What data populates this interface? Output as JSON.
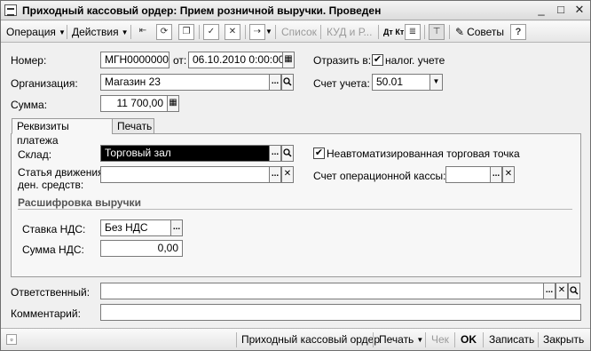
{
  "window": {
    "title": "Приходный кассовый ордер: Прием розничной выручки. Проведен",
    "minimize": "_",
    "maximize": "□",
    "close": "✕"
  },
  "toolbar": {
    "operation": "Операция",
    "actions": "Действия",
    "list": "Список",
    "kud": "КУД и Р...",
    "dtkt": "Дт Кт",
    "tips": "Советы",
    "help": "?"
  },
  "form": {
    "number_label": "Номер:",
    "number_value": "МГН00000002",
    "from_label": "от:",
    "date_value": "06.10.2010  0:00:00",
    "reflect_label": "Отразить в:",
    "tax_label": "налог. учете",
    "org_label": "Организация:",
    "org_value": "Магазин 23",
    "account_label": "Счет учета:",
    "account_value": "50.01",
    "sum_label": "Сумма:",
    "sum_value": "11 700,00"
  },
  "tabs": [
    {
      "label": "Реквизиты платежа",
      "active": true
    },
    {
      "label": "Печать",
      "active": false
    }
  ],
  "payment": {
    "warehouse_label": "Склад:",
    "warehouse_value": "Торговый зал",
    "nonauto_label": "Неавтоматизированная торговая точка",
    "cashflow_label_1": "Статья движения",
    "cashflow_label_2": "ден. средств:",
    "cashflow_value": "",
    "opcash_label": "Счет операционной кассы:",
    "opcash_value": "",
    "vat_section": "Расшифровка выручки",
    "vat_rate_label": "Ставка НДС:",
    "vat_rate_value": "Без НДС",
    "vat_sum_label": "Сумма НДС:",
    "vat_sum_value": "0,00"
  },
  "footer": {
    "responsible_label": "Ответственный:",
    "responsible_value": "",
    "comment_label": "Комментарий:",
    "comment_value": ""
  },
  "bottombar": {
    "order": "Приходный кассовый ордер",
    "print": "Печать",
    "check": "Чек",
    "ok": "OK",
    "save": "Записать",
    "close": "Закрыть"
  },
  "icons": {
    "dots": "...",
    "clear": "✕",
    "search": "🔍",
    "calendar": "▦",
    "calculator": "▦",
    "dropdown": "▼",
    "check": "✔"
  }
}
